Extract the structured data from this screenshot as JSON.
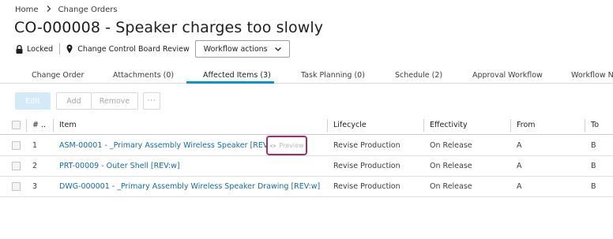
{
  "breadcrumb": {
    "home": "Home",
    "current": "Change Orders"
  },
  "page": {
    "title": "CO-000008 - Speaker charges too slowly"
  },
  "status": {
    "lock_label": "Locked",
    "location_label": "Change Control Board Review",
    "workflow_button": "Workflow actions"
  },
  "tabs": [
    {
      "label": "Change Order",
      "active": false
    },
    {
      "label": "Attachments (0)",
      "active": false
    },
    {
      "label": "Affected Items (3)",
      "active": true
    },
    {
      "label": "Task Planning (0)",
      "active": false
    },
    {
      "label": "Schedule (2)",
      "active": false
    },
    {
      "label": "Approval Workflow",
      "active": false
    },
    {
      "label": "Workflow Ne",
      "active": false
    }
  ],
  "toolbar": {
    "edit": "Edit",
    "add": "Add",
    "remove": "Remove",
    "more": "···"
  },
  "table": {
    "headers": {
      "num": "# ..",
      "item": "Item",
      "lifecycle": "Lifecycle",
      "effectivity": "Effectivity",
      "from": "From",
      "to": "To"
    },
    "rows": [
      {
        "num": "1",
        "item": "ASM-00001 - _Primary Assembly Wireless Speaker [REV:w]",
        "lifecycle": "Revise Production",
        "effectivity": "On Release",
        "from": "A",
        "to": "B"
      },
      {
        "num": "2",
        "item": "PRT-00009 - Outer Shell [REV:w]",
        "lifecycle": "Revise Production",
        "effectivity": "On Release",
        "from": "A",
        "to": "B"
      },
      {
        "num": "3",
        "item": "DWG-000001 - _Primary Assembly Wireless Speaker Drawing [REV:w]",
        "lifecycle": "Revise Production",
        "effectivity": "On Release",
        "from": "A",
        "to": "B"
      }
    ]
  },
  "preview": {
    "label": "Preview",
    "icon": "eye-icon"
  },
  "colors": {
    "accent": "#0696d7",
    "link": "#0b6fb0",
    "highlight": "#b1286a"
  }
}
